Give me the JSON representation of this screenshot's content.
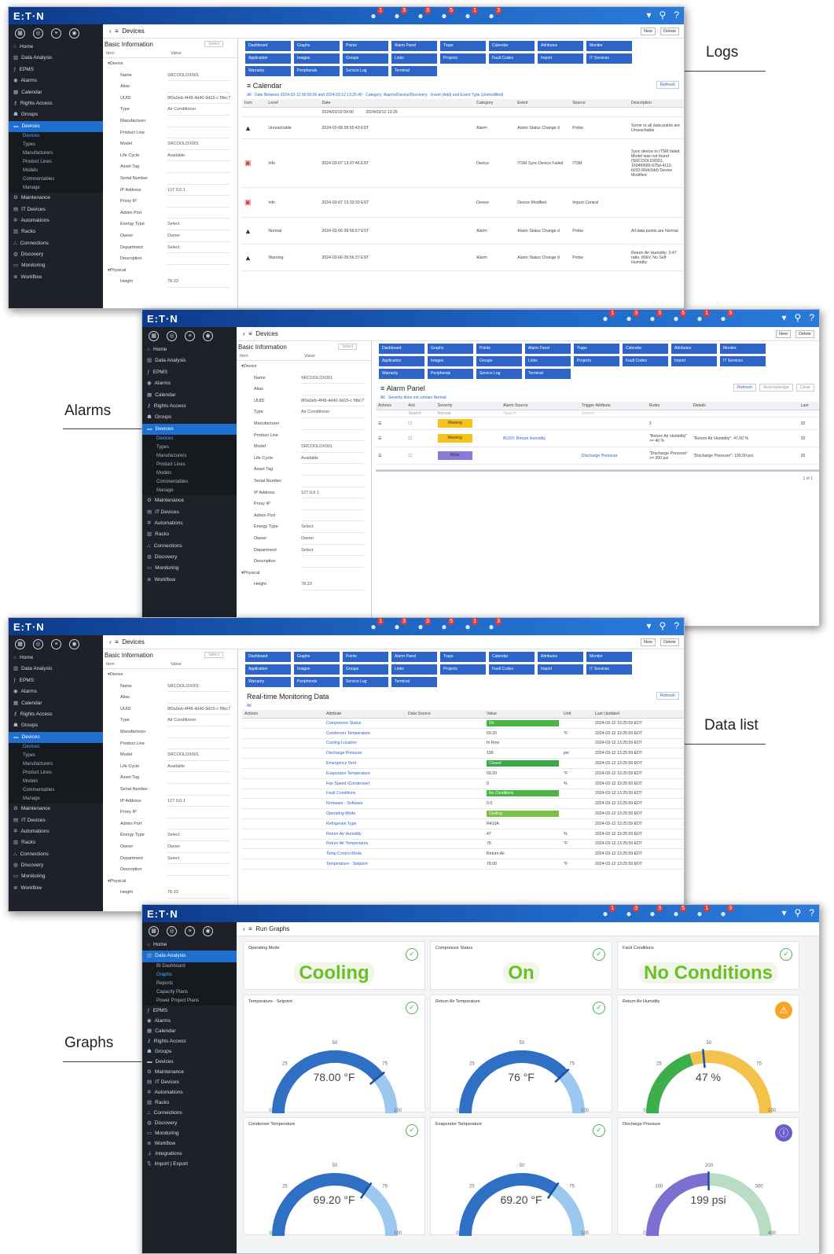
{
  "labels": {
    "logs": "Logs",
    "alarms": "Alarms",
    "data_list": "Data list",
    "graphs": "Graphs"
  },
  "app": {
    "brand": "E:T·N",
    "badges": [
      "1",
      "3",
      "3",
      "5",
      "1",
      "3"
    ],
    "new": "New",
    "delete": "Delete",
    "select": "Select"
  },
  "breadcrumb": {
    "devices": "Devices",
    "run_graphs": "Run Graphs"
  },
  "sidebar": {
    "main": [
      {
        "icon": "home-icon",
        "label": "Home"
      },
      {
        "icon": "bar-chart-icon",
        "label": "Data Analysis"
      },
      {
        "icon": "function-icon",
        "label": "EPMS"
      },
      {
        "icon": "alarm-bell-icon",
        "label": "Alarms"
      },
      {
        "icon": "calendar-icon",
        "label": "Calendar"
      },
      {
        "icon": "key-icon",
        "label": "Rights Access"
      },
      {
        "icon": "users-icon",
        "label": "Groups"
      },
      {
        "icon": "server-icon",
        "label": "Devices"
      }
    ],
    "devices_sub": [
      "Devices",
      "Types",
      "Manufacturers",
      "Product Lines",
      "Models",
      "Commentables",
      "Manage"
    ],
    "rest": [
      {
        "icon": "wrench-icon",
        "label": "Maintenance"
      },
      {
        "icon": "building-icon",
        "label": "IT Devices"
      },
      {
        "icon": "gear-icon",
        "label": "Automations"
      },
      {
        "icon": "rack-icon",
        "label": "Racks"
      },
      {
        "icon": "connection-icon",
        "label": "Connections"
      },
      {
        "icon": "discovery-icon",
        "label": "Discovery"
      },
      {
        "icon": "monitor-icon",
        "label": "Monitoring"
      },
      {
        "icon": "workflow-icon",
        "label": "Workflow"
      }
    ],
    "analysis_sub": [
      "BI Dashboard",
      "Graphs",
      "Reports",
      "Capacity Plans",
      "Power Project Plans"
    ],
    "graphs_rest": [
      {
        "icon": "function-icon",
        "label": "EPMS"
      },
      {
        "icon": "alarm-bell-icon",
        "label": "Alarms"
      },
      {
        "icon": "calendar-icon",
        "label": "Calendar"
      },
      {
        "icon": "key-icon",
        "label": "Rights Access"
      },
      {
        "icon": "users-icon",
        "label": "Groups"
      },
      {
        "icon": "server-icon",
        "label": "Devices"
      },
      {
        "icon": "wrench-icon",
        "label": "Maintenance"
      },
      {
        "icon": "building-icon",
        "label": "IT Devices"
      },
      {
        "icon": "gear-icon",
        "label": "Automations"
      },
      {
        "icon": "rack-icon",
        "label": "Racks"
      },
      {
        "icon": "connection-icon",
        "label": "Connections"
      },
      {
        "icon": "discovery-icon",
        "label": "Discovery"
      },
      {
        "icon": "monitor-icon",
        "label": "Monitoring"
      },
      {
        "icon": "workflow-icon",
        "label": "Workflow"
      },
      {
        "icon": "plug-icon",
        "label": "Integrations"
      },
      {
        "icon": "import-icon",
        "label": "Import | Export"
      }
    ]
  },
  "basic_info": {
    "title": "Basic Information",
    "col_item": "Item",
    "col_value": "Value",
    "group": "Device",
    "rows": [
      [
        "Name",
        "SRCOOLDX001"
      ],
      [
        "Alias",
        ""
      ],
      [
        "UUID",
        "8f0a0eb-4f48-4d40-9d15-c f9bc70b090"
      ],
      [
        "Type",
        "Air Conditioner"
      ],
      [
        "Manufacturer",
        ""
      ],
      [
        "Product Line",
        ""
      ],
      [
        "Model",
        "SRCOOLDX001"
      ],
      [
        "Life Cycle",
        "Available"
      ],
      [
        "Asset Tag",
        ""
      ],
      [
        "Serial Number",
        ""
      ],
      [
        "IP Address",
        "127.0.0.1"
      ],
      [
        "Proxy IP",
        ""
      ],
      [
        "Admin Port",
        ""
      ],
      [
        "Energy Type",
        "Select"
      ],
      [
        "Owner",
        "Owner"
      ],
      [
        "Department",
        "Select"
      ],
      [
        "Description",
        ""
      ]
    ],
    "group2": "Physical",
    "height_label": "Height",
    "height": "78.33"
  },
  "toolbar": [
    "Dashboard",
    "Graphs",
    "Points",
    "Alarm Panel",
    "Traps",
    "Calendar",
    "Attributes",
    "Monitor",
    "Application",
    "Images",
    "Groups",
    "Links",
    "Projects",
    "Fault Codes",
    "Import",
    "IT Services",
    "Warranty",
    "Peripherals",
    "Service Log",
    "Terminal"
  ],
  "logs": {
    "title": "Calendar",
    "refresh": "Refresh",
    "filter": "All · Date Between 2024-03-12 00:00:00 and 2024-03-12 13:25:40 · Category: Alarms/Device/Discovery · Event (Add) and Event Type (Unmodified)",
    "cols": [
      "Icon",
      "Level",
      "Date",
      "Category",
      "Event",
      "Source",
      "Description"
    ],
    "filter_from": "2024/03/10 09:00",
    "filter_to": "2024/03/12 13:25",
    "rows": [
      {
        "icon": "bell-icon",
        "level": "Unreachable",
        "date": "2024-03-08 09:55:43 EST",
        "cat": "Alarm",
        "event": "Alarm Status Change d",
        "source": "Probe",
        "desc": "Some or all data points are Unreachable"
      },
      {
        "icon": "device-icon",
        "level": "Info",
        "date": "2024-03-07 13:37:46 EST",
        "cat": "Device",
        "event": "ITSM Sync Device Failed",
        "source": "ITSM",
        "desc": "Sync device to ITSM failed. Model was not found (SRCOOLDX001, 1604f0680-675d-4112-b033-66dc0dd) Device Modified"
      },
      {
        "icon": "device-icon",
        "level": "Info",
        "date": "2024-03-07 13:33:33 EST",
        "cat": "Device",
        "event": "Device Modified",
        "source": "Import Central",
        "desc": ""
      },
      {
        "icon": "bell-icon",
        "level": "Normal",
        "date": "2024-03-06 09:56:57 EST",
        "cat": "Alarm",
        "event": "Alarm Status Change d",
        "source": "Probe",
        "desc": "All data points are Normal"
      },
      {
        "icon": "bell-icon",
        "level": "Warning",
        "date": "2024-03-06 09:56:37 EST",
        "cat": "Alarm",
        "event": "Alarm Status Change d",
        "source": "Probe",
        "desc": "Return Air Humidity: 0.47 ratio, 80kV, No Self Humidity"
      }
    ]
  },
  "alarms": {
    "title": "Alarm Panel",
    "buttons": [
      "Refresh",
      "Acknowledge",
      "Clear"
    ],
    "filter": "All · Severity does not contain Normal",
    "cols": [
      "Actions",
      "Ack",
      "Severity",
      "Alarm Source",
      "Trigger Attribute",
      "Rules",
      "Details",
      "Last"
    ],
    "search": "Search",
    "normal": "Normal",
    "rows": [
      {
        "sev": "Warning",
        "source": "",
        "trigger": "",
        "rules": "2",
        "details": "",
        "last": "20"
      },
      {
        "sev": "Warning",
        "source": "BUSY: Return Humidity",
        "trigger": "",
        "rules": "\"Return Air Humidity\" >= 40 %",
        "details": "\"Return Air Humidity\": 47.00 %",
        "last": "20"
      },
      {
        "sev": "Minor",
        "source": "",
        "trigger": "Discharge Pressure",
        "rules": "\"Discharge Pressure\" >= 200 psi",
        "details": "\"Discharge Pressure\": 199.00 psi",
        "last": "20"
      }
    ],
    "pager": "1 of 1"
  },
  "datalist": {
    "title": "Real-time Monitoring Data",
    "refresh": "Refresh",
    "filter": "All",
    "cols": [
      "Actions",
      "Attribute",
      "Data Source",
      "Value",
      "Unit",
      "Last Updated"
    ],
    "rows": [
      {
        "attr": "Compressor Status",
        "val": "On",
        "unit": "",
        "color": "#4bb543",
        "t": "2024-03-12 13:25:59 EDT"
      },
      {
        "attr": "Condenser Temperature",
        "val": "69.20",
        "unit": "°F",
        "color": "",
        "t": "2024-03-12 13:25:59 EDT"
      },
      {
        "attr": "Cooling Location",
        "val": "In Row",
        "unit": "",
        "color": "",
        "t": "2024-03-12 13:25:59 EDT"
      },
      {
        "attr": "Discharge Pressure",
        "val": "199",
        "unit": "psi",
        "color": "",
        "t": "2024-03-12 13:25:59 EDT"
      },
      {
        "attr": "Emergency Vent",
        "val": "Closed",
        "unit": "",
        "color": "#39a845",
        "t": "2024-03-12 13:25:59 EDT"
      },
      {
        "attr": "Evaporator Temperature",
        "val": "69.20",
        "unit": "°F",
        "color": "",
        "t": "2024-03-12 13:25:59 EDT"
      },
      {
        "attr": "Fan Speed (Condenser)",
        "val": "0",
        "unit": "%",
        "color": "",
        "t": "2024-03-12 13:25:59 EDT"
      },
      {
        "attr": "Fault Conditions",
        "val": "No Conditions",
        "unit": "",
        "color": "#4bb543",
        "t": "2024-03-12 13:25:59 EDT"
      },
      {
        "attr": "Firmware - Software",
        "val": "0.0",
        "unit": "",
        "color": "",
        "t": "2024-03-12 13:25:59 EDT"
      },
      {
        "attr": "Operating Mode",
        "val": "Cooling",
        "unit": "",
        "color": "#7ac142",
        "t": "2024-03-12 13:25:59 EDT"
      },
      {
        "attr": "Refrigerant Type",
        "val": "R410A",
        "unit": "",
        "color": "",
        "t": "2024-03-12 13:25:59 EDT"
      },
      {
        "attr": "Return Air Humidity",
        "val": "47",
        "unit": "%",
        "color": "",
        "t": "2024-03-12 13:25:59 EDT"
      },
      {
        "attr": "Return Air Temperature",
        "val": "76",
        "unit": "°F",
        "color": "",
        "t": "2024-03-12 13:25:59 EDT"
      },
      {
        "attr": "Temp Control Mode",
        "val": "Return Air",
        "unit": "",
        "color": "",
        "t": "2024-03-12 13:25:59 EDT"
      },
      {
        "attr": "Temperature - Setpoint",
        "val": "78.00",
        "unit": "°F",
        "color": "",
        "t": "2024-03-12 13:25:59 EDT"
      }
    ]
  },
  "graphs": {
    "status": [
      {
        "title": "Operating Mode",
        "value": "Cooling"
      },
      {
        "title": "Compressor Status",
        "value": "On"
      },
      {
        "title": "Fault Conditions",
        "value": "No Conditions"
      }
    ],
    "gauges": [
      {
        "title": "Temperature - Setpoint",
        "value": 78,
        "display": "78.00 °F",
        "min": 0,
        "max": 100,
        "ticks": [
          "0",
          "25",
          "50",
          "75",
          "100"
        ],
        "badge": "ok",
        "colors": [
          "#2f6fc4",
          "#9cc7ef"
        ]
      },
      {
        "title": "Return Air Temperature",
        "value": 76,
        "display": "76 °F",
        "min": 0,
        "max": 100,
        "ticks": [
          "0",
          "25",
          "50",
          "75",
          "100"
        ],
        "badge": "ok",
        "colors": [
          "#2f6fc4",
          "#9cc7ef"
        ]
      },
      {
        "title": "Return Air Humidity",
        "value": 47,
        "display": "47 %",
        "min": 0,
        "max": 100,
        "ticks": [
          "0",
          "25",
          "50",
          "75",
          "100"
        ],
        "badge": "warn",
        "colors": [
          "#3cae4c",
          "#f3c24b"
        ]
      },
      {
        "title": "Condenser Temperature",
        "value": 69.2,
        "display": "69.20 °F",
        "min": 0,
        "max": 100,
        "ticks": [
          "0",
          "25",
          "50",
          "75",
          "100"
        ],
        "badge": "ok",
        "colors": [
          "#2f6fc4",
          "#9cc7ef"
        ]
      },
      {
        "title": "Evaporator Temperature",
        "value": 69.2,
        "display": "69.20 °F",
        "min": 0,
        "max": 100,
        "ticks": [
          "0",
          "25",
          "50",
          "75",
          "100"
        ],
        "badge": "ok",
        "colors": [
          "#2f6fc4",
          "#9cc7ef"
        ]
      },
      {
        "title": "Discharge Pressure",
        "value": 199,
        "display": "199 psi",
        "min": 0,
        "max": 400,
        "ticks": [
          "0",
          "100",
          "200",
          "300",
          "400"
        ],
        "badge": "info",
        "colors": [
          "#7b6fd1",
          "#b9dcc4"
        ]
      }
    ]
  }
}
